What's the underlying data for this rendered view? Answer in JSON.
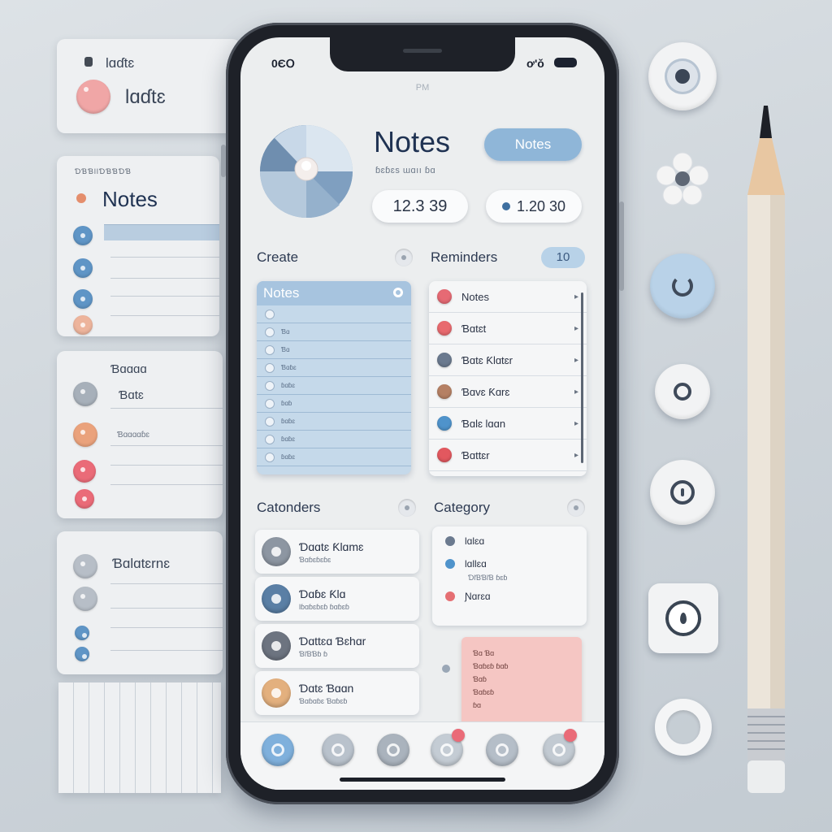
{
  "status_bar": {
    "time": "0ЄՕ",
    "right": "ơ'ǒ"
  },
  "pm_label": "PM",
  "header": {
    "title": "Notes",
    "subtitle": "ɓɛɓɛs ɯɑıı ɓɑ",
    "button_label": "Notes",
    "counter_left": "12.3 39",
    "counter_right": "1.20 30"
  },
  "sections": {
    "create": "Create",
    "reminders": "Reminders",
    "reminders_badge": "10",
    "calendars": "Catonders",
    "category": "Category"
  },
  "notes_list": {
    "title": "Notes",
    "rows": [
      "",
      "Ɓɑ",
      "Ɓɑ",
      "Ɓɑɓɛ",
      "ɓɑɓɛ",
      "ɓɑɓ",
      "ɓɑɓɛ",
      "ɓɑɓɛ",
      "ɓɑɓɛ"
    ]
  },
  "reminders": [
    {
      "label": "Notes",
      "color": "#e66a74"
    },
    {
      "label": "Ɓɑtɛt",
      "color": "#e86a6f"
    },
    {
      "label": "Ɓɑtɛ Ƙlɑtɛr",
      "color": "#6b7a8f"
    },
    {
      "label": "Ɓɑvɛ Ƙɑrɛ",
      "color": "#b58064"
    },
    {
      "label": "Ɓɑlɛ lɑɑn",
      "color": "#4f93cb"
    },
    {
      "label": "Ɓɑttɛr",
      "color": "#e2585f"
    }
  ],
  "calendar_items": [
    {
      "title": "Ɗɑɑtɛ Ƙlɑmɛ",
      "sub": "Ɓɑɓɛɓɛɓɛ",
      "color": "#8d96a2"
    },
    {
      "title": "Ɗɑɓɛ Ƙlɑ",
      "sub": "Ɩɓɑɓɛɓɛɓ ɓɑɓɛɓ",
      "color": "#5a7fa5"
    },
    {
      "title": "Ɗɑttɛɑ Ɓɛhɑr",
      "sub": "ƁƖƁƁɓ ɓ",
      "color": "#6d7480"
    },
    {
      "title": "Ɗɑtɛ Ɓɑɑn",
      "sub": "Ɓɑɓɑɓɛ Ɓɑɓɛɓ",
      "color": "#e3b07e"
    }
  ],
  "category": [
    {
      "label": "Ɩɑlɛɑ",
      "sub": "",
      "color": "#6b7a8f"
    },
    {
      "label": "Ɩɑllɛɑ",
      "sub": "ƊƖƁƁƖƁ ɓɛɓ",
      "color": "#4f93cb"
    },
    {
      "label": "Ɲɑrɛɑ",
      "sub": "",
      "color": "#e56f73"
    }
  ],
  "sticky_note": [
    "Ɓɑ Ɓɑ",
    "Ɓɑɓɛɓ ɓɑɓ",
    "Ɓɑɓ",
    "Ɓɑɓɛɓ",
    "ɓɑ"
  ],
  "tabs": [
    {
      "icon": "notes-tab-icon",
      "color": "#7fb0dc"
    },
    {
      "icon": "compass-tab-icon",
      "color": "#b9c2cc"
    },
    {
      "icon": "photo-tab-icon",
      "color": "#aab3bd"
    },
    {
      "icon": "alert-tab-icon",
      "color": "#c4ccd4"
    },
    {
      "icon": "sync-tab-icon",
      "color": "#b5bec8"
    },
    {
      "icon": "profile-tab-icon",
      "color": "#c2cad2"
    }
  ],
  "left_cards": {
    "top_line1": "Ɩɑɗtɛ",
    "top_line2": "Ɩɑɗtɛ",
    "notes_kicker": "ƊƁƁƖƖƊƁƁƊƁ",
    "notes_title": "Notes",
    "second_title": "Ɓɑɑɑɑ",
    "second_sub": "Ɓɑtɛ",
    "second_row": "Ɓɑɑɑɑɓɛ",
    "third_title": "Ɓɑlɑtɛrnɛ"
  },
  "colors": {
    "accent_blue": "#8fb6d8",
    "accent_pink": "#ea6b78",
    "sticky_pink": "#f5c6c3",
    "background": "#d3d9de"
  }
}
